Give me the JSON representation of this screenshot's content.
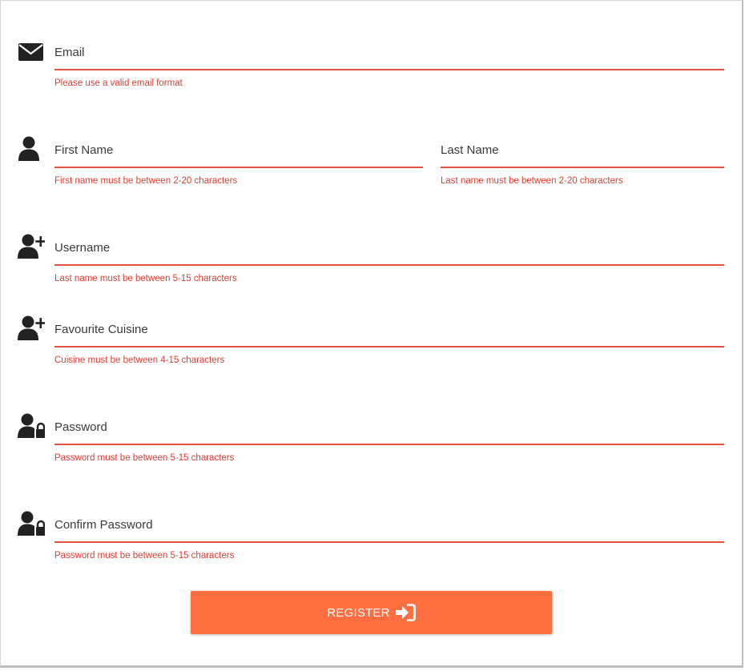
{
  "form": {
    "email": {
      "label": "Email",
      "error": "Please use a valid email format",
      "icon": "envelope-icon"
    },
    "first_name": {
      "label": "First Name",
      "error": "First name must be between 2-20 characters",
      "icon": "user-icon"
    },
    "last_name": {
      "label": "Last Name",
      "error": "Last name must be between 2-20 characters"
    },
    "username": {
      "label": "Username",
      "error": "Last name must be between 5-15 characters",
      "icon": "user-plus-icon"
    },
    "cuisine": {
      "label": "Favourite Cuisine",
      "error": "Cuisine must be between 4-15 characters",
      "icon": "user-plus-icon"
    },
    "password": {
      "label": "Password",
      "error": "Password must be between 5-15 characters",
      "icon": "user-lock-icon"
    },
    "confirm_password": {
      "label": "Confirm Password",
      "error": "Password must be between 5-15 characters",
      "icon": "user-lock-icon"
    },
    "register_label": "REGISTER"
  },
  "colors": {
    "error": "#e03c31",
    "underline": "#e2533d",
    "button": "#ff6e40",
    "icon": "#222222"
  }
}
